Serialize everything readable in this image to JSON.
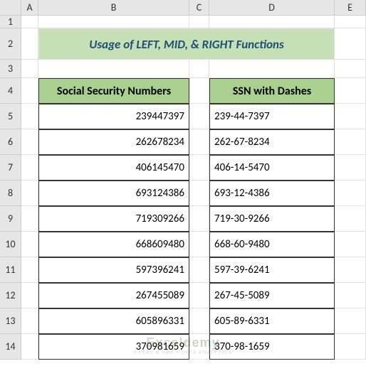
{
  "columns": [
    "A",
    "B",
    "C",
    "D",
    "E"
  ],
  "rows": [
    "1",
    "2",
    "3",
    "4",
    "5",
    "6",
    "7",
    "8",
    "9",
    "10",
    "11",
    "12",
    "13",
    "14"
  ],
  "title": "Usage of LEFT, MID, & RIGHT Functions",
  "headers": {
    "b": "Social Security Numbers",
    "d": "SSN with Dashes"
  },
  "chart_data": {
    "type": "table",
    "title": "Usage of LEFT, MID, & RIGHT Functions",
    "columns": [
      "Social Security Numbers",
      "SSN with Dashes"
    ],
    "rows": [
      {
        "ssn": "239447397",
        "dashed": "239-44-7397"
      },
      {
        "ssn": "262678234",
        "dashed": "262-67-8234"
      },
      {
        "ssn": "406145470",
        "dashed": "406-14-5470"
      },
      {
        "ssn": "693124386",
        "dashed": "693-12-4386"
      },
      {
        "ssn": "719309266",
        "dashed": "719-30-9266"
      },
      {
        "ssn": "668609480",
        "dashed": "668-60-9480"
      },
      {
        "ssn": "597396241",
        "dashed": "597-39-6241"
      },
      {
        "ssn": "267455089",
        "dashed": "267-45-5089"
      },
      {
        "ssn": "605896331",
        "dashed": "605-89-6331"
      },
      {
        "ssn": "370981659",
        "dashed": "370-98-1659"
      }
    ]
  },
  "watermark": {
    "brand1": "Excel",
    "brand2": "demy",
    "tagline": "EXCEL & VBA + DATA ANALYTICS"
  }
}
